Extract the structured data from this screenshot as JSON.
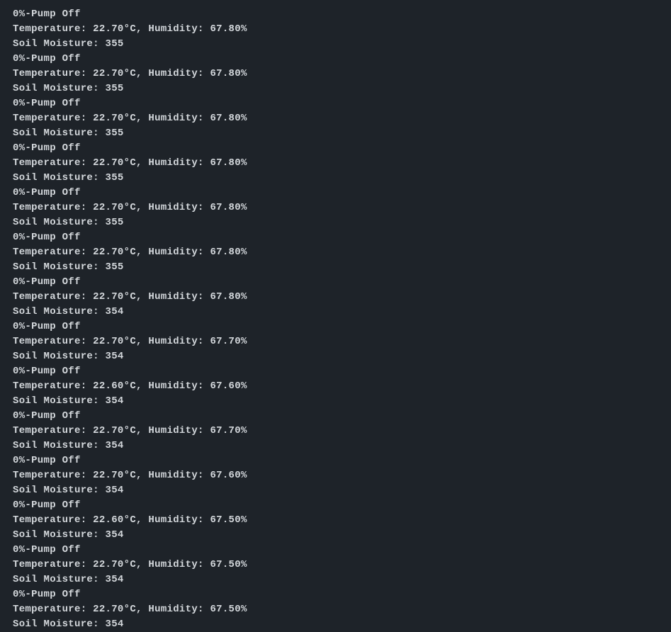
{
  "terminal": {
    "entries": [
      {
        "pump": "0%-Pump Off",
        "temp": "22.70",
        "humidity": "67.80",
        "moisture": "355"
      },
      {
        "pump": "0%-Pump Off",
        "temp": "22.70",
        "humidity": "67.80",
        "moisture": "355"
      },
      {
        "pump": "0%-Pump Off",
        "temp": "22.70",
        "humidity": "67.80",
        "moisture": "355"
      },
      {
        "pump": "0%-Pump Off",
        "temp": "22.70",
        "humidity": "67.80",
        "moisture": "355"
      },
      {
        "pump": "0%-Pump Off",
        "temp": "22.70",
        "humidity": "67.80",
        "moisture": "355"
      },
      {
        "pump": "0%-Pump Off",
        "temp": "22.70",
        "humidity": "67.80",
        "moisture": "355"
      },
      {
        "pump": "0%-Pump Off",
        "temp": "22.70",
        "humidity": "67.80",
        "moisture": "354"
      },
      {
        "pump": "0%-Pump Off",
        "temp": "22.70",
        "humidity": "67.70",
        "moisture": "354"
      },
      {
        "pump": "0%-Pump Off",
        "temp": "22.60",
        "humidity": "67.60",
        "moisture": "354"
      },
      {
        "pump": "0%-Pump Off",
        "temp": "22.70",
        "humidity": "67.70",
        "moisture": "354"
      },
      {
        "pump": "0%-Pump Off",
        "temp": "22.70",
        "humidity": "67.60",
        "moisture": "354"
      },
      {
        "pump": "0%-Pump Off",
        "temp": "22.60",
        "humidity": "67.50",
        "moisture": "354"
      },
      {
        "pump": "0%-Pump Off",
        "temp": "22.70",
        "humidity": "67.50",
        "moisture": "354"
      },
      {
        "pump": "0%-Pump Off",
        "temp": "22.70",
        "humidity": "67.50",
        "moisture": "354"
      }
    ],
    "first_entry_start_index": 1,
    "labels": {
      "temperature_prefix": "Temperature: ",
      "temperature_suffix": "°C, ",
      "humidity_prefix": "Humidity: ",
      "humidity_suffix": "%",
      "moisture_prefix": "Soil Moisture: "
    }
  }
}
